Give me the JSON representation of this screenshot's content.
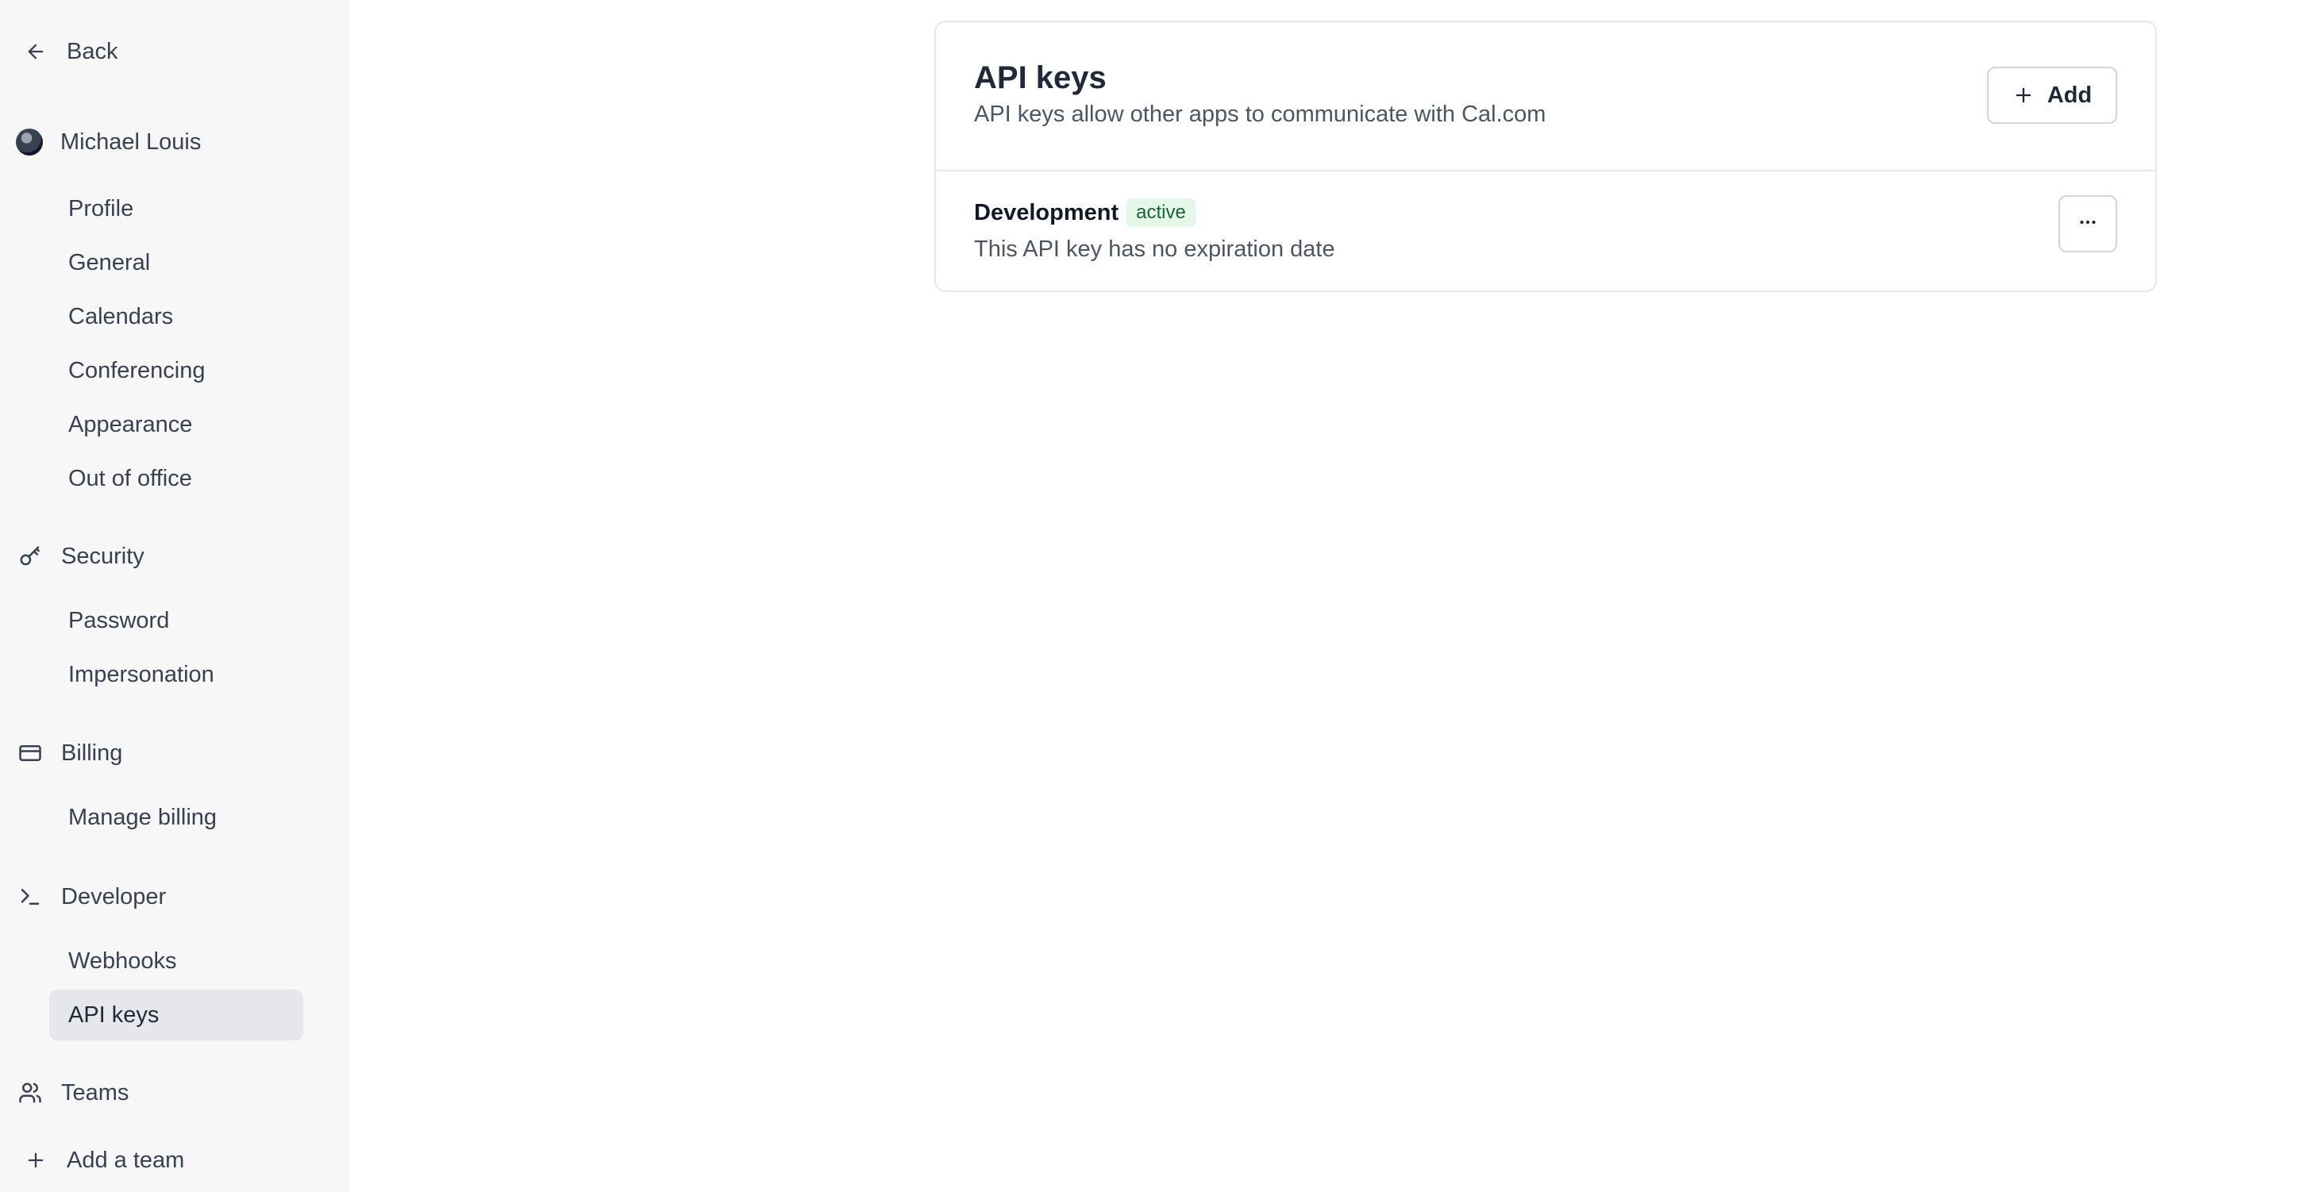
{
  "sidebar": {
    "back": {
      "label": "Back",
      "icon": "arrow-left-icon"
    },
    "user": {
      "name": "Michael Louis",
      "icon": "avatar"
    },
    "profile_items": [
      {
        "label": "Profile"
      },
      {
        "label": "General"
      },
      {
        "label": "Calendars"
      },
      {
        "label": "Conferencing"
      },
      {
        "label": "Appearance"
      },
      {
        "label": "Out of office"
      }
    ],
    "security": {
      "label": "Security",
      "icon": "key-icon"
    },
    "security_items": [
      {
        "label": "Password"
      },
      {
        "label": "Impersonation"
      }
    ],
    "billing": {
      "label": "Billing",
      "icon": "credit-card-icon"
    },
    "billing_items": [
      {
        "label": "Manage billing"
      }
    ],
    "developer": {
      "label": "Developer",
      "icon": "terminal-icon"
    },
    "developer_items": [
      {
        "label": "Webhooks",
        "active": false
      },
      {
        "label": "API keys",
        "active": true
      }
    ],
    "teams": {
      "label": "Teams",
      "icon": "users-icon"
    },
    "add_team": {
      "label": "Add a team",
      "icon": "plus-icon"
    }
  },
  "main": {
    "title": "API keys",
    "description": "API keys allow other apps to communicate with Cal.com",
    "add_button": {
      "label": "Add",
      "icon": "plus-icon"
    },
    "keys": [
      {
        "name": "Development",
        "status": "active",
        "expiration_text": "This API key has no expiration date",
        "menu_icon": "more-horizontal-icon"
      }
    ]
  },
  "colors": {
    "sidebar_bg": "#f7f7f8",
    "active_item_bg": "#e5e7eb",
    "badge_bg": "#e4f7e8",
    "badge_text": "#166534"
  }
}
